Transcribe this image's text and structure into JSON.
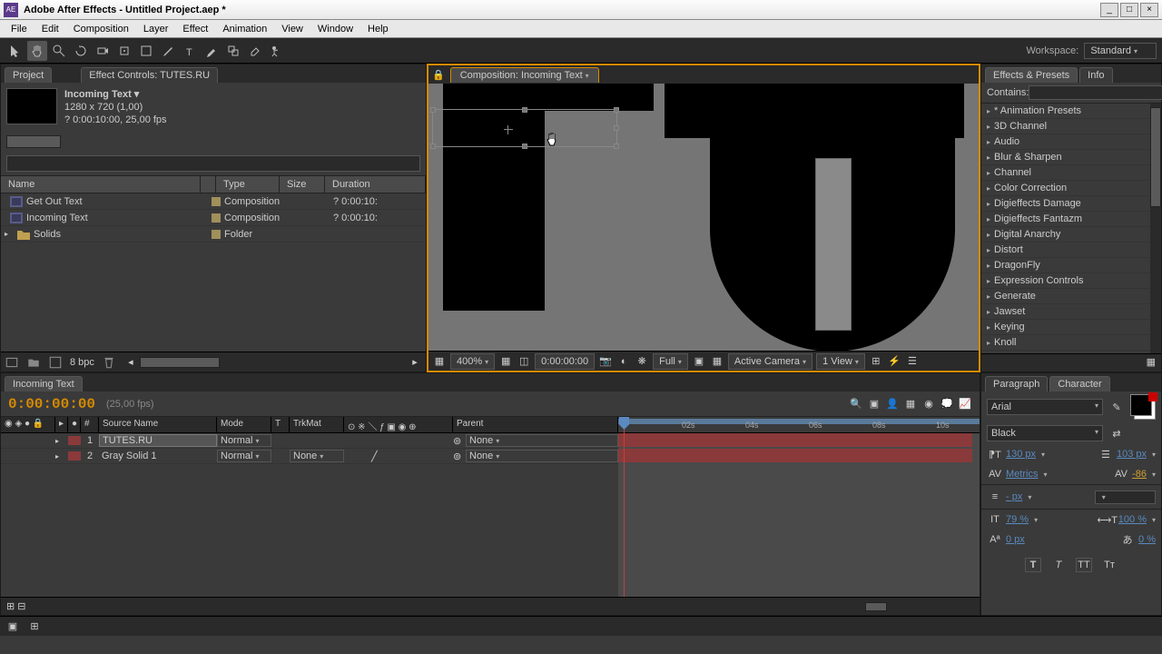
{
  "title": "Adobe After Effects - Untitled Project.aep *",
  "menu": [
    "File",
    "Edit",
    "Composition",
    "Layer",
    "Effect",
    "Animation",
    "View",
    "Window",
    "Help"
  ],
  "workspace": {
    "label": "Workspace:",
    "value": "Standard"
  },
  "project": {
    "tab": "Project",
    "tab2": "Effect Controls: TUTES.RU",
    "info_name": "Incoming Text ▾",
    "info_dim": "1280 x 720 (1,00)",
    "info_dur": "? 0:00:10:00, 25,00 fps",
    "columns": {
      "name": "Name",
      "type": "Type",
      "size": "Size",
      "duration": "Duration"
    },
    "rows": [
      {
        "name": "Get Out Text",
        "type": "Composition",
        "dur": "? 0:00:10:"
      },
      {
        "name": "Incoming Text",
        "type": "Composition",
        "dur": "? 0:00:10:"
      },
      {
        "name": "Solids",
        "type": "Folder",
        "dur": ""
      }
    ],
    "bpc": "8 bpc"
  },
  "comp": {
    "tab": "Composition: Incoming Text",
    "zoom": "400%",
    "time": "0:00:00:00",
    "res": "Full",
    "camera": "Active Camera",
    "view": "1 View"
  },
  "effects": {
    "tab": "Effects & Presets",
    "tab2": "Info",
    "contains": "Contains:",
    "list": [
      "* Animation Presets",
      "3D Channel",
      "Audio",
      "Blur & Sharpen",
      "Channel",
      "Color Correction",
      "Digieffects Damage",
      "Digieffects Fantazm",
      "Digital Anarchy",
      "Distort",
      "DragonFly",
      "Expression Controls",
      "Generate",
      "Jawset",
      "Keying",
      "Knoll"
    ]
  },
  "timeline": {
    "tab": "Incoming Text",
    "timecode": "0:00:00:00",
    "fps": "(25,00 fps)",
    "cols": {
      "num": "#",
      "source": "Source Name",
      "mode": "Mode",
      "t": "T",
      "trkmat": "TrkMat",
      "parent": "Parent"
    },
    "layers": [
      {
        "n": "1",
        "name": "TUTES.RU",
        "mode": "Normal",
        "trk": "",
        "parent": "None"
      },
      {
        "n": "2",
        "name": "Gray Solid 1",
        "mode": "Normal",
        "trk": "None",
        "parent": "None"
      }
    ],
    "ticks": [
      "02s",
      "04s",
      "06s",
      "08s",
      "10s"
    ]
  },
  "character": {
    "tab1": "Paragraph",
    "tab2": "Character",
    "font": "Arial",
    "style": "Black",
    "size": "130 px",
    "leading": "103 px",
    "kerning": "Metrics",
    "tracking": "-86",
    "stroke": "- px",
    "vscale": "79 %",
    "hscale": "100 %",
    "baseline": "0 px",
    "tsume": "0 %"
  }
}
